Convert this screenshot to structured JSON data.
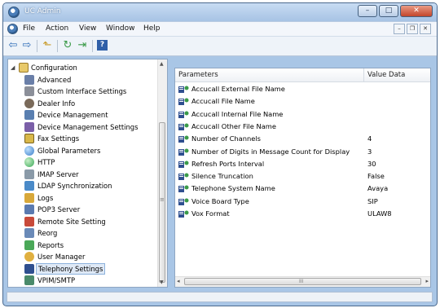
{
  "window": {
    "title": "UC Admin",
    "min_label": "–",
    "max_label": "□",
    "close_label": "✕"
  },
  "menubar": {
    "items": [
      "File",
      "Action",
      "View",
      "Window",
      "Help"
    ],
    "mdi_min": "–",
    "mdi_restore": "❐",
    "mdi_close": "✕"
  },
  "toolbar": {
    "buttons": [
      {
        "name": "back",
        "icon": "⇦"
      },
      {
        "name": "forward",
        "icon": "⇨"
      },
      {
        "name": "up-folder",
        "icon": "⬑"
      },
      {
        "name": "refresh",
        "icon": "↻"
      },
      {
        "name": "export-list",
        "icon": "⇥"
      },
      {
        "name": "help",
        "icon": "?"
      }
    ]
  },
  "tree": {
    "root": {
      "label": "Configuration",
      "expander": "◢"
    },
    "items": [
      {
        "label": "Advanced",
        "icon": "advanced-icon",
        "color": "#6a7fa8"
      },
      {
        "label": "Custom Interface Settings",
        "icon": "custom-interface-icon",
        "color": "#8b8f99"
      },
      {
        "label": "Dealer Info",
        "icon": "dealer-info-icon",
        "color": "#7a6a5a"
      },
      {
        "label": "Device Management",
        "icon": "device-management-icon",
        "color": "#5a7fb0"
      },
      {
        "label": "Device Management Settings",
        "icon": "device-settings-icon",
        "color": "#7b5fa8"
      },
      {
        "label": "Fax Settings",
        "icon": "fax-icon",
        "color": "#d9b84a"
      },
      {
        "label": "Global Parameters",
        "icon": "globe-icon",
        "color": "#3a7ec8"
      },
      {
        "label": "HTTP",
        "icon": "http-icon",
        "color": "#3aa858"
      },
      {
        "label": "IMAP Server",
        "icon": "imap-icon",
        "color": "#8a9aa8"
      },
      {
        "label": "LDAP Synchronization",
        "icon": "ldap-icon",
        "color": "#4a8ac8"
      },
      {
        "label": "Logs",
        "icon": "logs-icon",
        "color": "#d8a83a"
      },
      {
        "label": "POP3 Server",
        "icon": "pop3-icon",
        "color": "#5a7ab0"
      },
      {
        "label": "Remote Site Setting",
        "icon": "remote-site-icon",
        "color": "#c84a3a"
      },
      {
        "label": "Reorg",
        "icon": "reorg-icon",
        "color": "#6a8ab8"
      },
      {
        "label": "Reports",
        "icon": "reports-icon",
        "color": "#4aa858"
      },
      {
        "label": "User Manager",
        "icon": "user-manager-icon",
        "color": "#e0b040"
      },
      {
        "label": "Telephony Settings",
        "icon": "telephony-icon",
        "color": "#2f4f8f",
        "selected": true
      },
      {
        "label": "VPIM/SMTP",
        "icon": "vpim-icon",
        "color": "#4a8a6a"
      }
    ],
    "scroll_up": "▲",
    "scroll_down": "▼",
    "thumb_grip": "≡"
  },
  "parameters": {
    "headers": {
      "name": "Parameters",
      "value": "Value Data"
    },
    "rows": [
      {
        "name": "Accucall External File Name",
        "value": ""
      },
      {
        "name": "Accucall File Name",
        "value": ""
      },
      {
        "name": "Accucall Internal File Name",
        "value": ""
      },
      {
        "name": "Accucall Other File Name",
        "value": ""
      },
      {
        "name": "Number of Channels",
        "value": "4"
      },
      {
        "name": "Number of Digits in Message Count for Display",
        "value": "3"
      },
      {
        "name": "Refresh Ports Interval",
        "value": "30"
      },
      {
        "name": "Silence Truncation",
        "value": "False"
      },
      {
        "name": "Telephone System Name",
        "value": "Avaya"
      },
      {
        "name": "Voice Board Type",
        "value": "SIP"
      },
      {
        "name": "Vox Format",
        "value": "ULAW8"
      }
    ],
    "scroll_left": "◂",
    "scroll_right": "▸",
    "thumb_grip": "III"
  },
  "colors": {
    "title_bg": "#a7c3e4",
    "selection": "#dfe9f6",
    "selection_border": "#8cb1dc"
  }
}
